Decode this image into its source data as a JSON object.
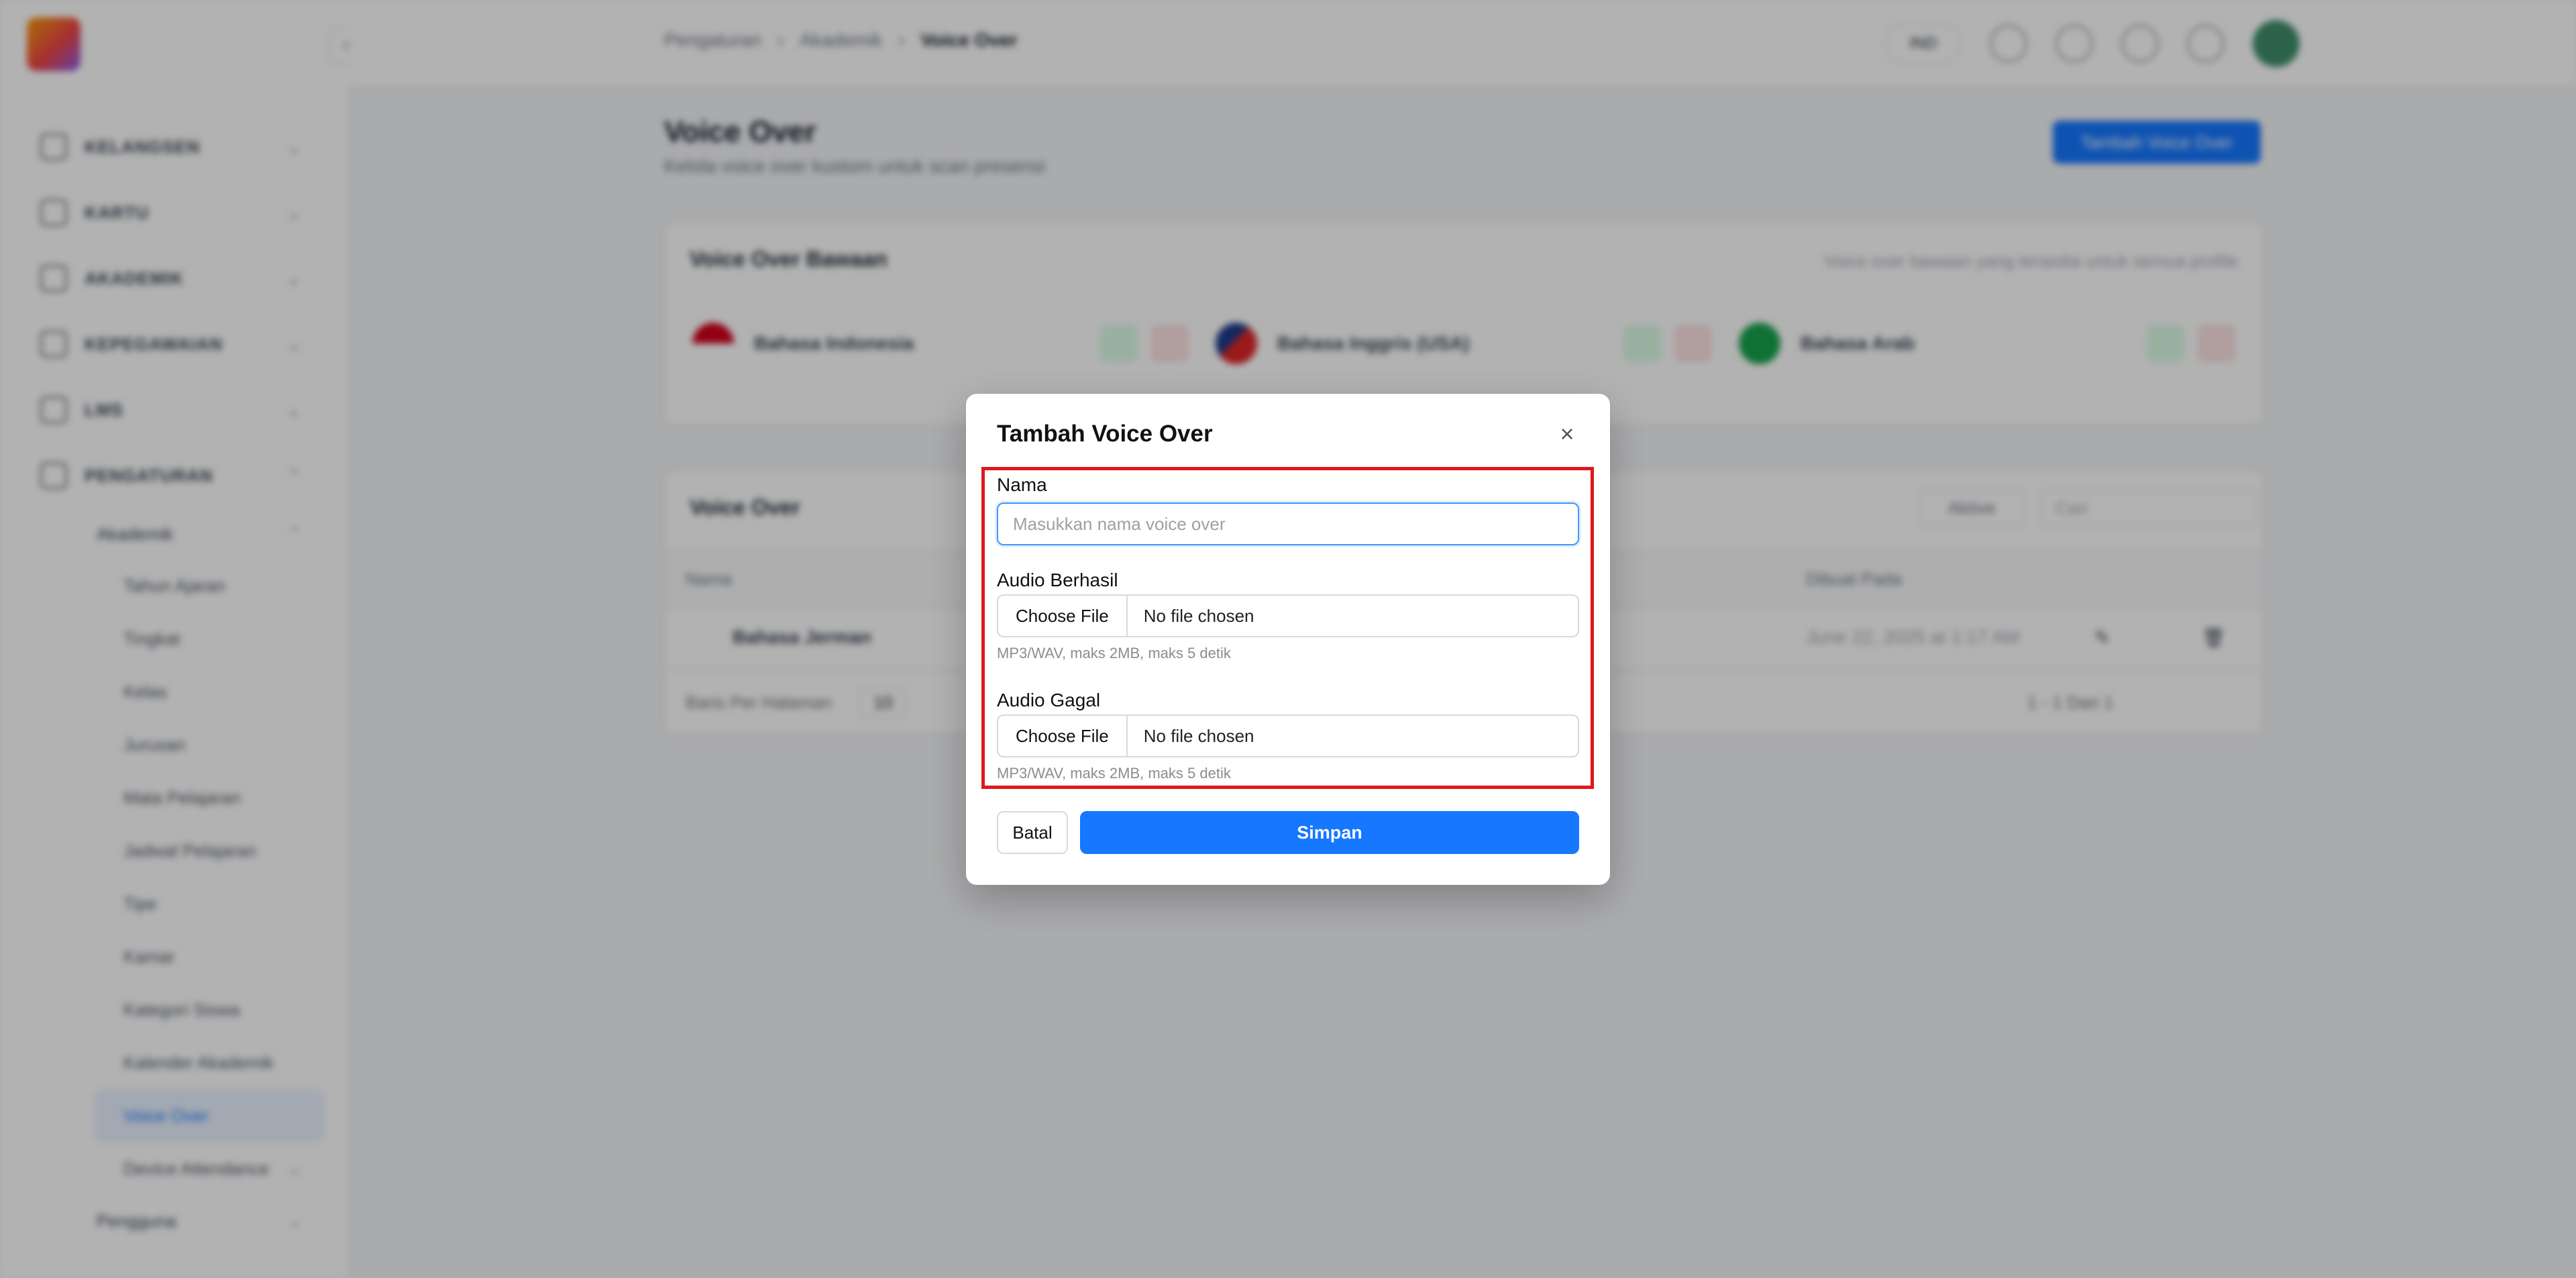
{
  "sidebar": {
    "groups": [
      "KELANGSEN",
      "KARTU",
      "AKADEMIK",
      "KEPEGAWAIAN",
      "LMS",
      "PENGATURAN"
    ],
    "sub_group": "Akademik",
    "sub_items": [
      "Tahun Ajaran",
      "Tingkat",
      "Kelas",
      "Jurusan",
      "Mata Pelajaran",
      "Jadwal Pelajaran",
      "Tipe",
      "Kamar",
      "Kategori Siswa",
      "Kalender Akademik",
      "Voice Over",
      "Device Attendance"
    ],
    "active_item": "Voice Over",
    "next_group": "Pengguna"
  },
  "topbar": {
    "breadcrumb": [
      "Pengaturan",
      "Akademik",
      "Voice Over"
    ],
    "lang": "IND"
  },
  "page": {
    "title": "Voice Over",
    "subtitle": "Kelola voice over kustom untuk scan presensi",
    "add_button": "Tambah Voice Over"
  },
  "default_card": {
    "title": "Voice Over Bawaan",
    "note": "Voice over bawaan yang tersedia untuk semua profile",
    "items": [
      "Bahasa Indonesia",
      "Bahasa Inggris (USA)",
      "Bahasa Arab"
    ]
  },
  "list_card": {
    "title": "Voice Over",
    "filter": "Aktive",
    "search": "Cari",
    "columns": [
      "Nama",
      "Dibuat Pada"
    ],
    "rows": [
      {
        "name": "Bahasa Jerman",
        "created": "June 22, 2025 at 1:17 AM"
      }
    ],
    "per_page_label": "Baris Per Halaman",
    "per_page": "10",
    "pagination": "1 - 1 Dari 1"
  },
  "modal": {
    "title": "Tambah Voice Over",
    "nama_label": "Nama",
    "nama_placeholder": "Masukkan nama voice over",
    "nama_value": "",
    "success_label": "Audio Berhasil",
    "success_choose": "Choose File",
    "success_file": "No file chosen",
    "success_hint": "MP3/WAV, maks 2MB, maks 5 detik",
    "fail_label": "Audio Gagal",
    "fail_choose": "Choose File",
    "fail_file": "No file chosen",
    "fail_hint": "MP3/WAV, maks 2MB, maks 5 detik",
    "cancel_label": "Batal",
    "save_label": "Simpan",
    "close_symbol": "×"
  },
  "colors": {
    "primary": "#1677ff",
    "highlight": "#e0171e"
  }
}
